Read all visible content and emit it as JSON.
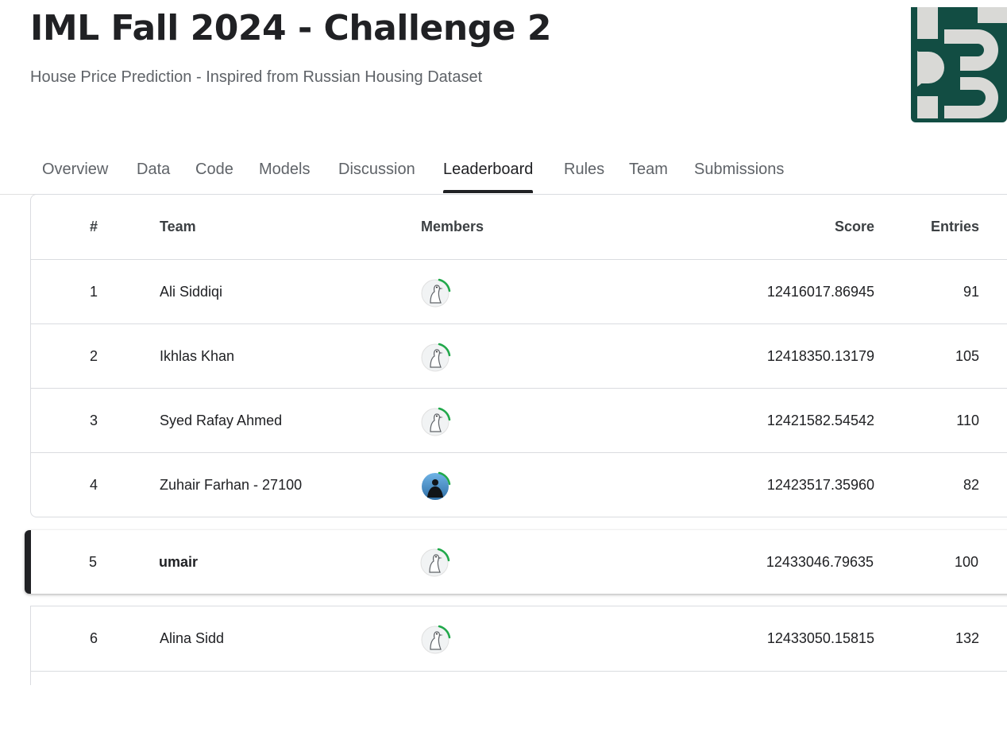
{
  "header": {
    "title": "IML Fall 2024 - Challenge 2",
    "subtitle": "House Price Prediction - Inspired from Russian Housing Dataset"
  },
  "tabs": [
    {
      "label": "Overview"
    },
    {
      "label": "Data"
    },
    {
      "label": "Code"
    },
    {
      "label": "Models"
    },
    {
      "label": "Discussion"
    },
    {
      "label": "Leaderboard",
      "active": true
    },
    {
      "label": "Rules"
    },
    {
      "label": "Team"
    },
    {
      "label": "Submissions"
    }
  ],
  "leaderboard": {
    "columns": {
      "rank": "#",
      "team": "Team",
      "members": "Members",
      "score": "Score",
      "entries": "Entries"
    },
    "rows": [
      {
        "rank": "1",
        "team": "Ali Siddiqi",
        "avatar": "goose-avatar-icon",
        "score": "12416017.86945",
        "entries": "91"
      },
      {
        "rank": "2",
        "team": "Ikhlas Khan",
        "avatar": "goose-avatar-icon",
        "score": "12418350.13179",
        "entries": "105"
      },
      {
        "rank": "3",
        "team": "Syed Rafay Ahmed",
        "avatar": "goose-avatar-icon",
        "score": "12421582.54542",
        "entries": "110"
      },
      {
        "rank": "4",
        "team": "Zuhair Farhan - 27100",
        "avatar": "person-photo-avatar",
        "score": "12423517.35960",
        "entries": "82"
      }
    ],
    "current_user": {
      "rank": "5",
      "team": "umair",
      "avatar": "goose-avatar-icon",
      "score": "12433046.79635",
      "entries": "100"
    },
    "after_rows": [
      {
        "rank": "6",
        "team": "Alina Sidd",
        "avatar": "goose-avatar-icon",
        "score": "12433050.15815",
        "entries": "132"
      }
    ]
  },
  "colors": {
    "logo_green": "#124d43",
    "logo_shape": "#d9d9d6",
    "progress_ring": "#20a84a",
    "active_tab": "#202124"
  }
}
